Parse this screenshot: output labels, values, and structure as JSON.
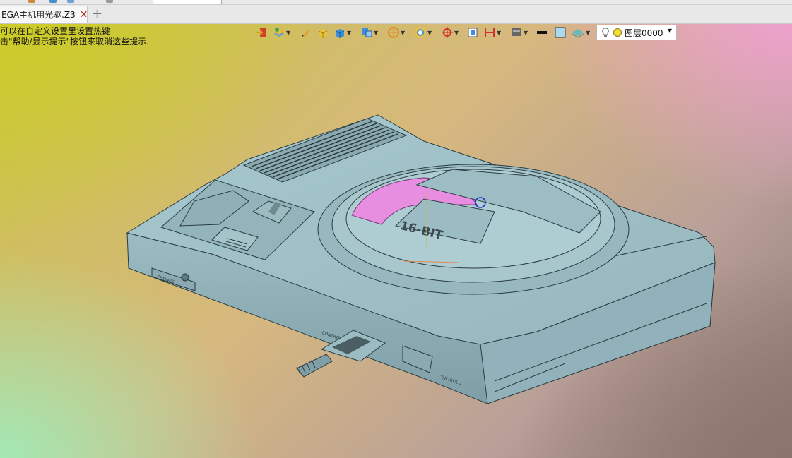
{
  "tab": {
    "title": "EGA主机用光驱.Z3",
    "close_icon": "close-icon",
    "add_icon": "plus-icon"
  },
  "hint": {
    "line1": "可以在自定义设置里设置热键",
    "line2": "击\"帮助/显示提示\"按钮来取消这些提示."
  },
  "toolbar": {
    "icons": [
      "exit-icon",
      "layer-manager-icon",
      "pen-icon",
      "solid-box-icon",
      "cube-icon",
      "view-cube-icon",
      "render-icon",
      "zoom-window-icon",
      "target-icon",
      "frame-icon",
      "dimension-icon",
      "display-icon",
      "line-color-icon",
      "face-color-icon",
      "shading-icon"
    ],
    "layer_value": "图层0000"
  },
  "model": {
    "label_cartridge": "16-BIT",
    "label_phones": "PHONES",
    "label_control1": "CONTROL 1",
    "label_control2": "CONTROL 2",
    "highlight_color": "#e78ee0",
    "body_color": "#9fc0c7"
  }
}
